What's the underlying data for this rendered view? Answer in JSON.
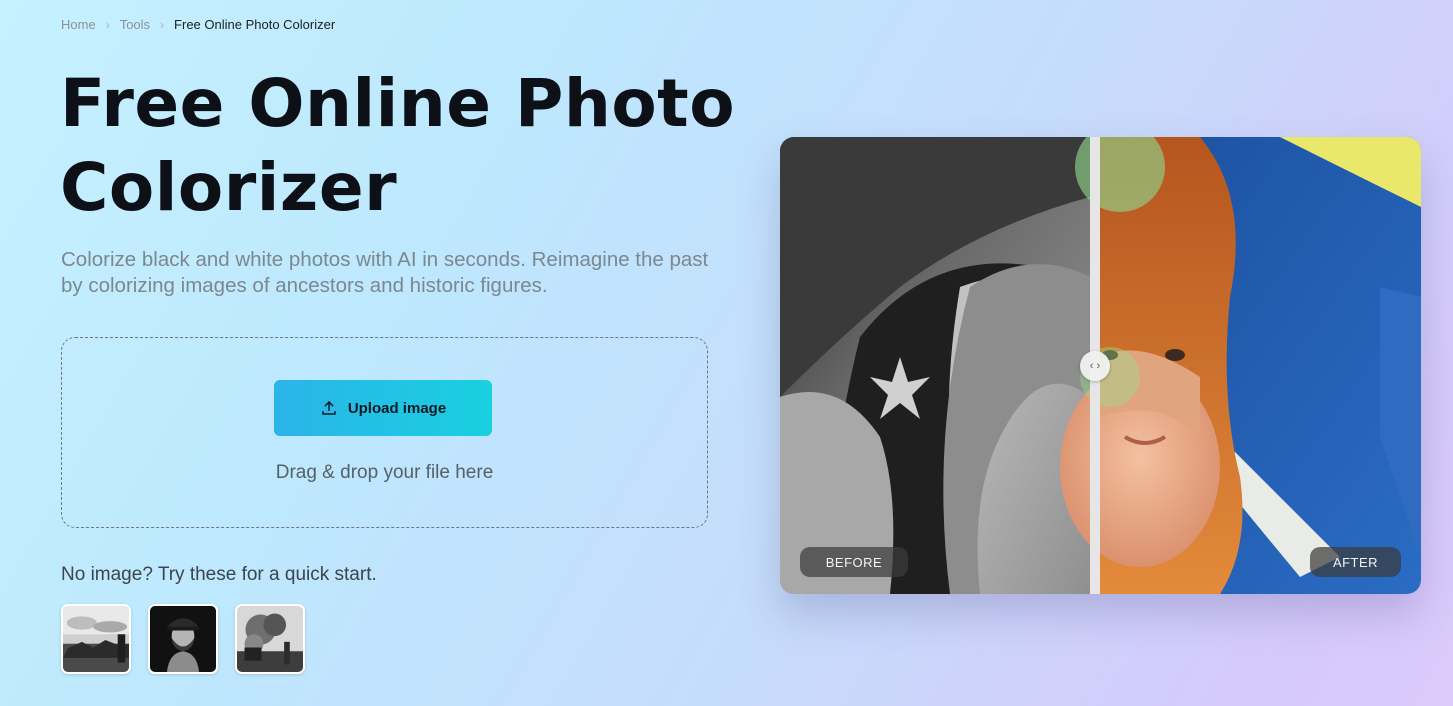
{
  "breadcrumb": {
    "items": [
      "Home",
      "Tools"
    ],
    "current": "Free Online Photo Colorizer"
  },
  "hero": {
    "title": "Free Online Photo Colorizer",
    "subtitle": "Colorize black and white photos with AI in seconds. Reimagine the past by colorizing images of ancestors and historic figures."
  },
  "dropzone": {
    "upload_label": "Upload image",
    "upload_icon": "upload-icon",
    "drop_text": "Drag & drop your file here"
  },
  "samples": {
    "prompt": "No image? Try these for a quick start.",
    "items": [
      "sample-landscape-bw",
      "sample-bearded-man-bw",
      "sample-smoke-bw"
    ]
  },
  "compare": {
    "before_label": "BEFORE",
    "after_label": "AFTER",
    "handle_icon": "split-arrows-icon",
    "split_fraction": 0.49
  },
  "colors": {
    "button_start": "#2bb4e8",
    "button_end": "#19d0e0",
    "title": "#0d1117"
  }
}
